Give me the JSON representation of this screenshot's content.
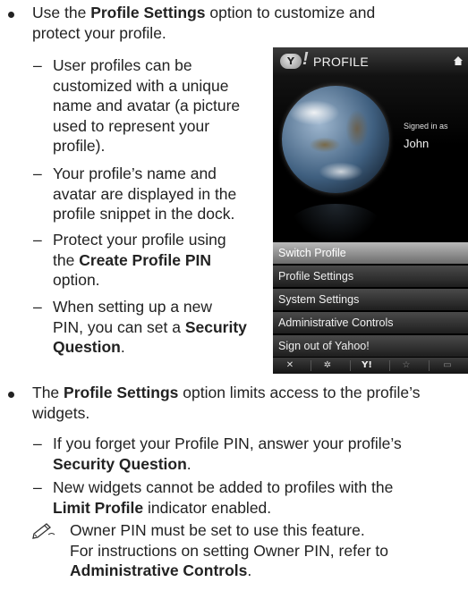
{
  "bullet1": {
    "prefix": "Use the ",
    "bold": "Profile Settings",
    "suffix_line1": " option to customize and",
    "line2": "protect your profile.",
    "subitems": [
      [
        "User profiles can be",
        "customized with a unique",
        "name and avatar (a picture",
        "used to represent your",
        "profile)."
      ],
      [
        "Your profile’s name and",
        "avatar are displayed in the",
        "profile snippet in the dock."
      ],
      {
        "l1": "Protect your profile using",
        "l2_prefix": "the ",
        "l2_bold": "Create Profile PIN",
        "l3": "option."
      },
      {
        "l1": "When setting up a new",
        "l2_prefix": "PIN, you can set a ",
        "l2_bold": "Security",
        "l3_bold": "Question",
        "l3_suffix": "."
      }
    ]
  },
  "bullet2": {
    "prefix": "The ",
    "bold": "Profile Settings",
    "suffix": " option limits access to the profile’s",
    "line2": "widgets.",
    "sub1": {
      "l1": "If you forget your Profile PIN, answer your profile’s",
      "l2_bold": "Security Question",
      "l2_suffix": "."
    },
    "sub2": {
      "l1": "New widgets cannot be added to profiles with the",
      "l2_bold": "Limit Profile",
      "l2_suffix": " indicator enabled."
    },
    "note": {
      "l1": "Owner PIN must be set to use this feature.",
      "l2": "For instructions on setting Owner PIN, refer to",
      "l3_bold": "Administrative Controls",
      "l3_suffix": "."
    }
  },
  "tv_screen": {
    "logo_text": "Y",
    "title": "PROFILE",
    "signed_in_as": "Signed in as",
    "user": "John",
    "menu": [
      "Switch Profile",
      "Profile Settings",
      "System Settings",
      "Administrative Controls",
      "Sign out of Yahoo!"
    ],
    "bottom_bar": [
      "close-icon",
      "gear-icon",
      "yahoo-icon",
      "star-icon",
      "widgets-icon"
    ]
  }
}
